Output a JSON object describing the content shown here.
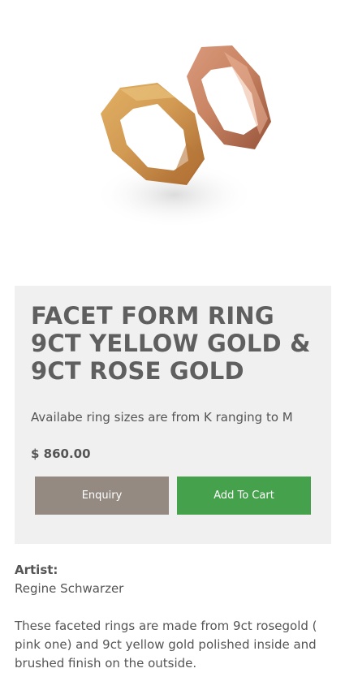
{
  "product": {
    "image_alt": "Facet form rings in yellow gold and rose gold",
    "title": "FACET FORM RING 9CT YELLOW GOLD & 9CT ROSE GOLD",
    "size_note": "Availabe ring sizes are from K ranging to M",
    "price": "$ 860.00",
    "colors": {
      "card_background": "#f0f0f0",
      "enquiry_button": "#948a82",
      "cart_button": "#45a14b",
      "yellow_gold": "#d29a53",
      "rose_gold": "#c98463"
    }
  },
  "actions": {
    "enquiry_label": "Enquiry",
    "cart_label": "Add To Cart"
  },
  "artist": {
    "label": "Artist:",
    "name": "Regine Schwarzer"
  },
  "description": "These faceted rings are made from 9ct rosegold ( pink one) and 9ct yellow gold polished inside and brushed finish on the outside."
}
